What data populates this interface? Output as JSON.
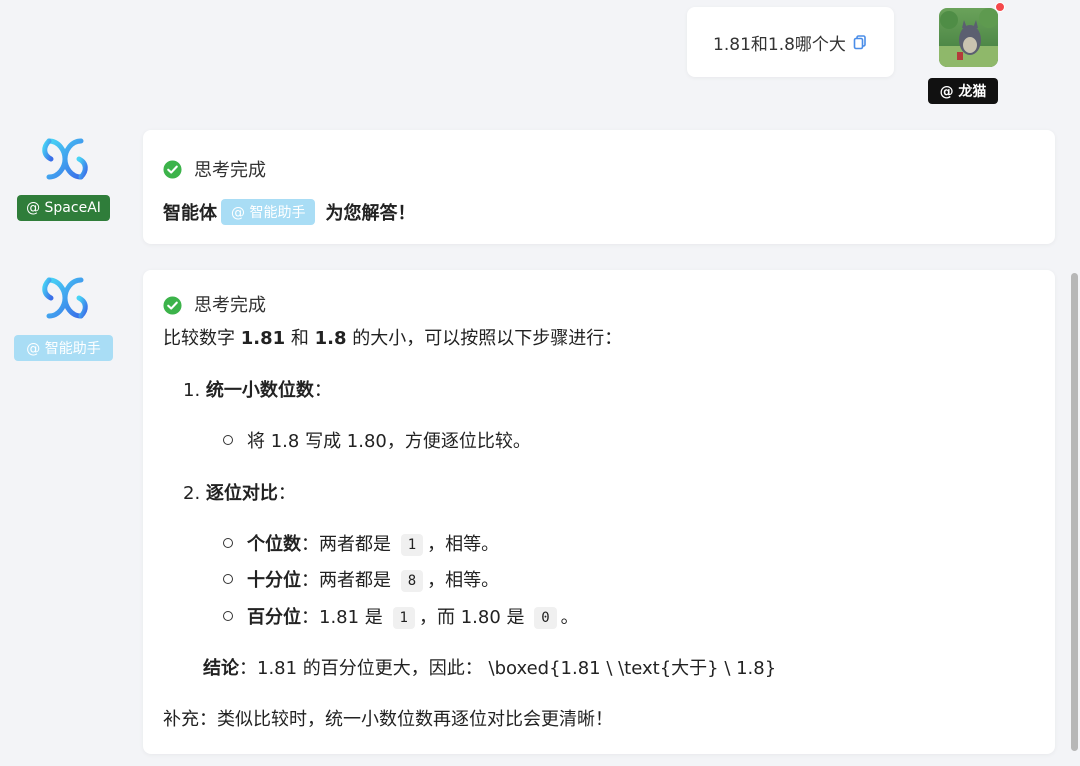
{
  "user_message": {
    "text": "1.81和1.8哪个大",
    "user_tag": "@ 龙猫"
  },
  "colors": {
    "accent_green": "#2f7d3a",
    "tag_blue": "#a9ddf5",
    "check_green": "#3cb34a",
    "notification_red": "#f5484b"
  },
  "messages": [
    {
      "agent_tag": "@ SpaceAI",
      "status": "思考完成",
      "intro_before": "智能体",
      "mention": "@ 智能助手",
      "intro_after": "为您解答！"
    },
    {
      "agent_tag": "@ 智能助手",
      "status": "思考完成",
      "answer": {
        "intro_a": "比较数字 ",
        "n1": "1.81",
        "intro_b": " 和 ",
        "n2": "1.8",
        "intro_c": " 的大小，可以按照以下步骤进行：",
        "step1_num": "1.",
        "step1_title": "统一小数位数",
        "step1_colon": "：",
        "step1_item": "将 1.8 写成 1.80，方便逐位比较。",
        "step2_num": "2.",
        "step2_title": "逐位对比",
        "step2_colon": "：",
        "items": [
          {
            "label": "个位数",
            "text_a": "：两者都是 ",
            "code": "1",
            "text_b": "，相等。"
          },
          {
            "label": "十分位",
            "text_a": "：两者都是 ",
            "code": "8",
            "text_b": "，相等。"
          },
          {
            "label": "百分位",
            "text_a": "：1.81 是 ",
            "code": "1",
            "text_b": "，而 1.80 是 ",
            "code2": "0",
            "text_c": "。"
          }
        ],
        "conclusion_label": "结论",
        "conclusion_text": "：1.81 的百分位更大，因此： \\boxed{1.81 \\ \\text{大于} \\ 1.8}",
        "supplement": "补充：类似比较时，统一小数位数再逐位对比会更清晰！"
      }
    }
  ]
}
